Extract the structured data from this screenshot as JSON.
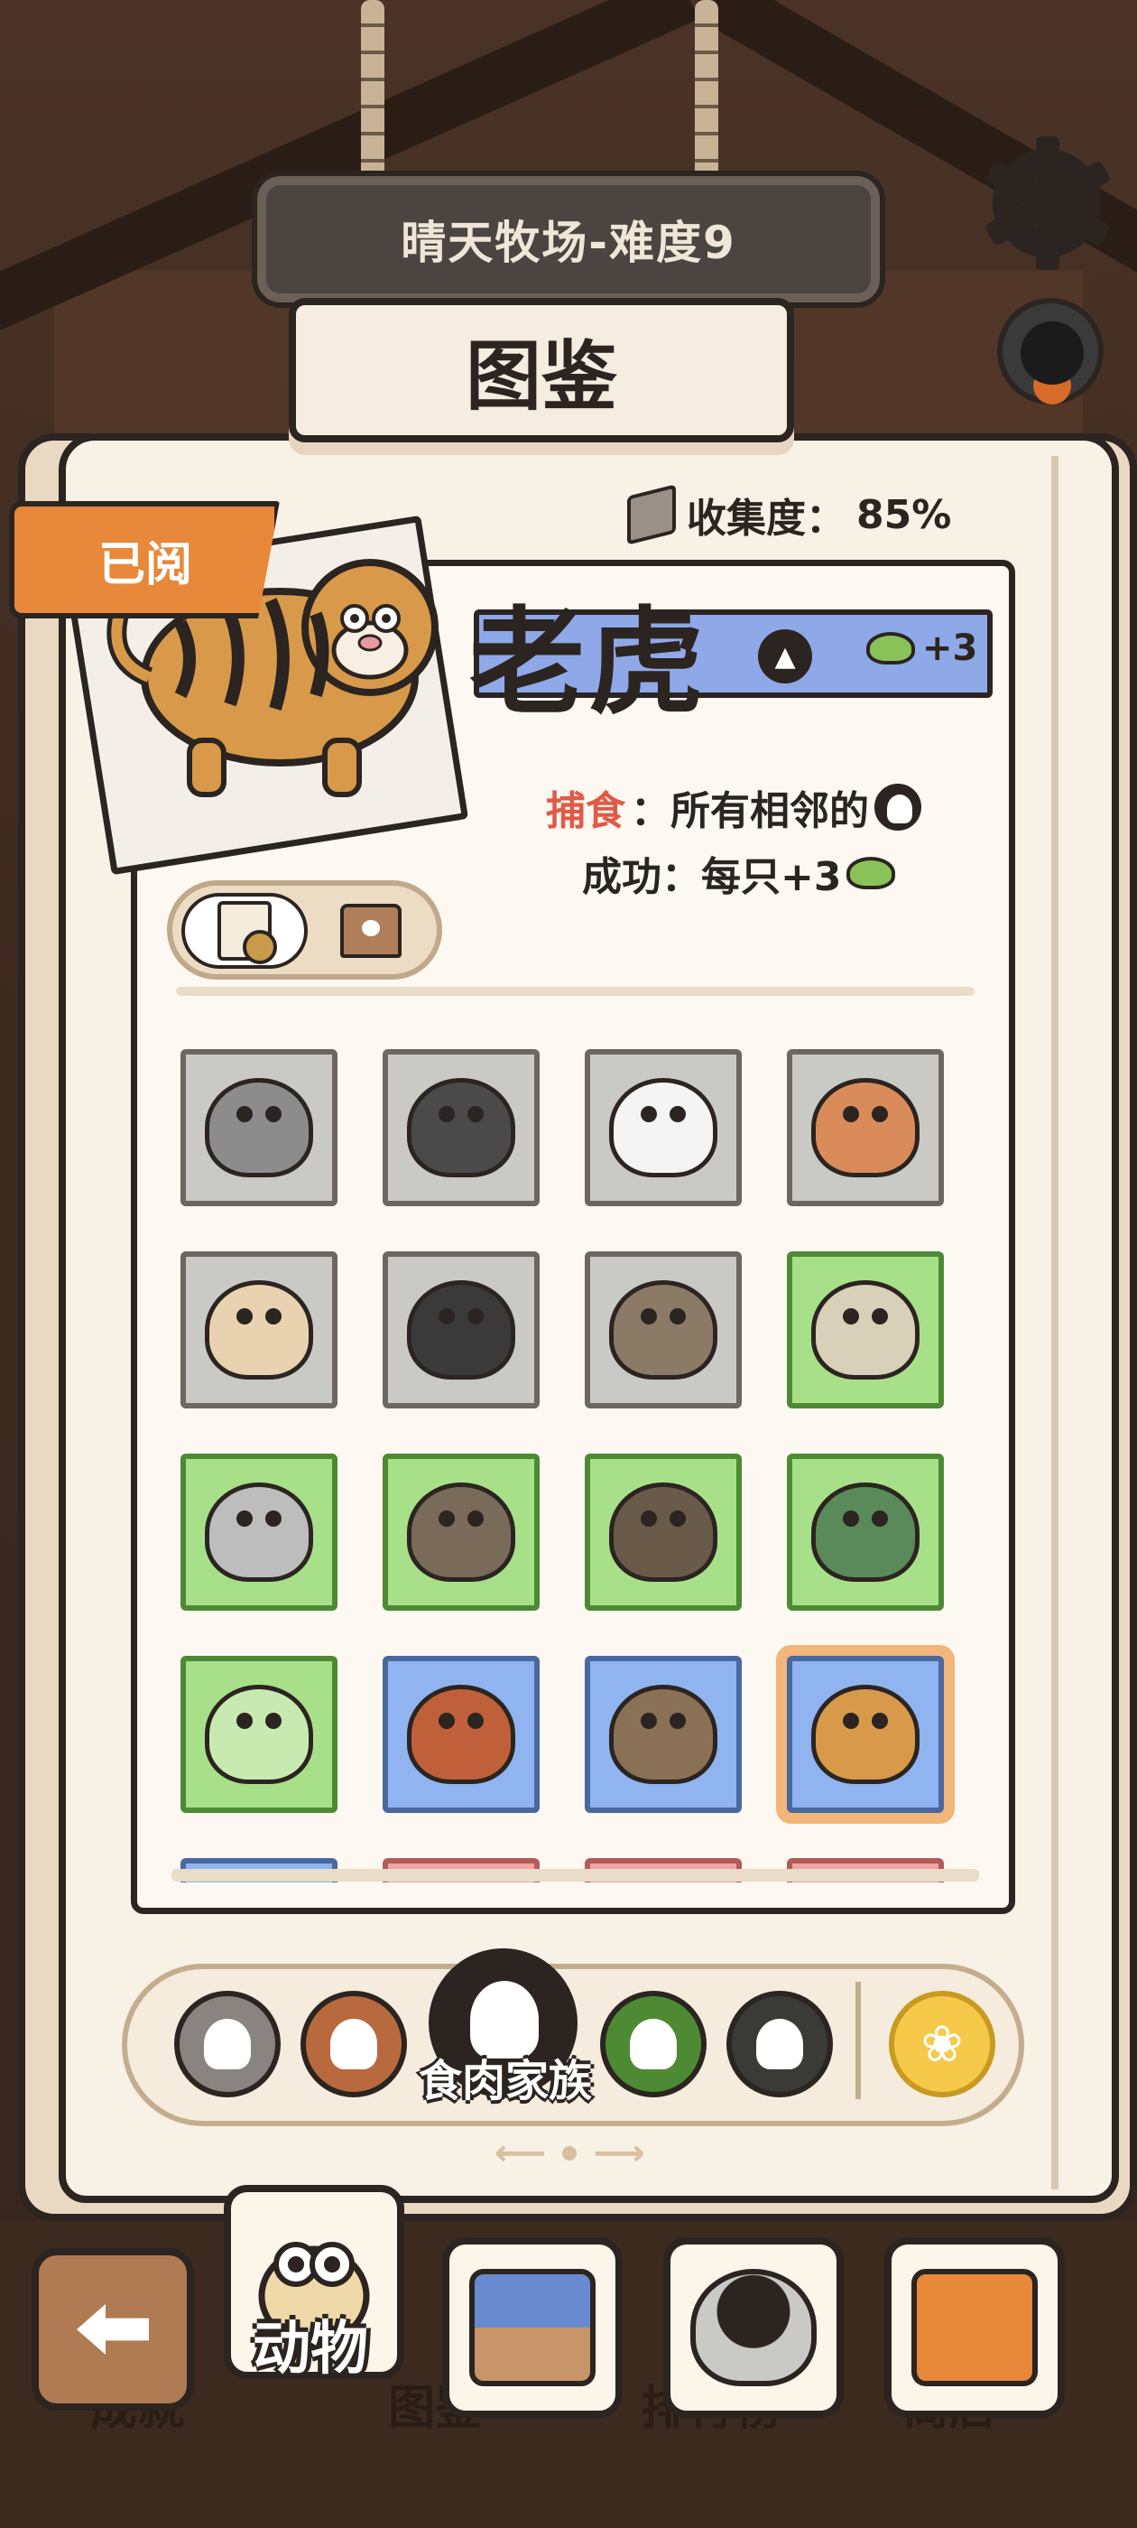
{
  "level_sign": "晴天牧场-难度9",
  "page_title": "图鉴",
  "collection": {
    "label": "收集度：",
    "value": "85%"
  },
  "read_tag": "已阅",
  "animal": {
    "name": "老虎",
    "bonus": "+3",
    "skill_key": "捕食",
    "skill_text": "：所有相邻的",
    "success_label": "成功：每只+3"
  },
  "grid": [
    {
      "name": "raccoon",
      "color": "gray",
      "body": "#8c8c8c"
    },
    {
      "name": "wolf",
      "color": "gray",
      "body": "#4a4a4a"
    },
    {
      "name": "sheepdog",
      "color": "gray",
      "body": "#f4f4f4"
    },
    {
      "name": "fox",
      "color": "gray",
      "body": "#d98c5a"
    },
    {
      "name": "hare",
      "color": "gray",
      "body": "#e8d2b0"
    },
    {
      "name": "skunk",
      "color": "gray",
      "body": "#3a3a3a"
    },
    {
      "name": "coyote",
      "color": "gray",
      "body": "#8a7a66"
    },
    {
      "name": "snow-leopard",
      "color": "green",
      "body": "#d8d0b8"
    },
    {
      "name": "badger",
      "color": "green",
      "body": "#bdbdbd"
    },
    {
      "name": "hyena",
      "color": "green",
      "body": "#7a6a5a"
    },
    {
      "name": "eagle",
      "color": "green",
      "body": "#6a5a4a"
    },
    {
      "name": "crocodile",
      "color": "green",
      "body": "#5a8a5a"
    },
    {
      "name": "unknown",
      "color": "green",
      "body": "#c8eab0"
    },
    {
      "name": "red-panda",
      "color": "blue",
      "body": "#c0603a"
    },
    {
      "name": "raccoon-dog",
      "color": "blue",
      "body": "#8a7055"
    },
    {
      "name": "tiger",
      "color": "blue",
      "body": "#d89a4a",
      "selected": true
    },
    {
      "name": "animal-17",
      "color": "blue",
      "body": "#9fbef2"
    },
    {
      "name": "panda",
      "color": "red",
      "body": "#f0f0f0"
    },
    {
      "name": "animal-19",
      "color": "red",
      "body": "#b8b0a8"
    },
    {
      "name": "animal-20",
      "color": "red",
      "body": "#5a8a5a"
    }
  ],
  "families": {
    "active_label": "食肉家族"
  },
  "nav": {
    "active_label": "动物",
    "tab_achievements": "成就",
    "tab_collection": "图鉴",
    "tab_ranking": "排行榜",
    "tab_shop": "商店"
  },
  "colors": {
    "accent_orange": "#e8883a",
    "name_bar": "#8fa8e8",
    "skill_red": "#e05a48"
  }
}
